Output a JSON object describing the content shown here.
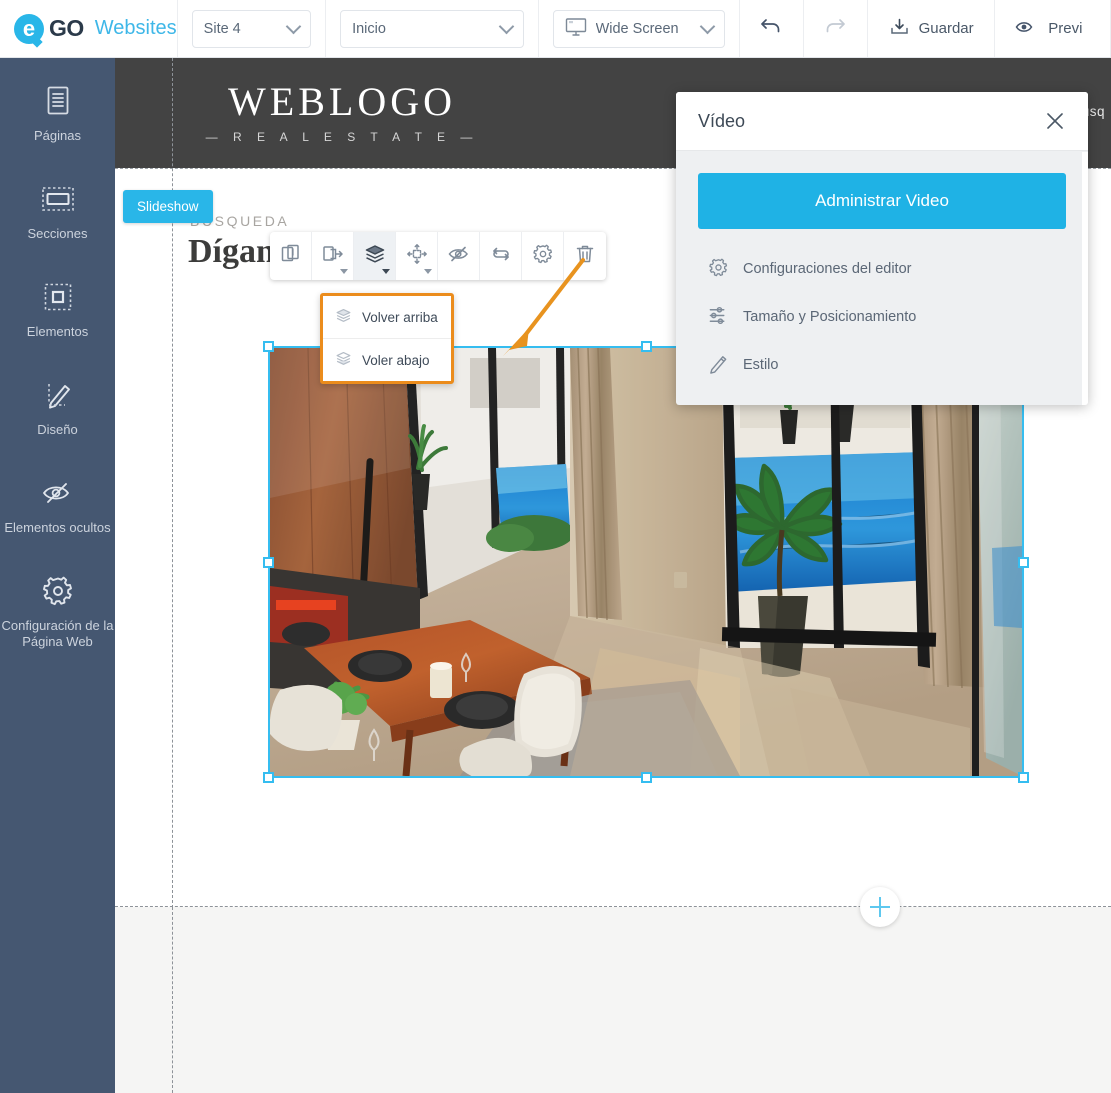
{
  "topbar": {
    "brand": {
      "mark": "e",
      "go": "GO",
      "word": "Websites"
    },
    "site_select": {
      "value": "Site 4",
      "icon": "chevron-down-icon"
    },
    "page_select": {
      "value": "Inicio",
      "icon": "chevron-down-icon"
    },
    "screen_select": {
      "value": "Wide Screen",
      "icon": "monitor-icon"
    },
    "undo": {
      "icon": "undo-arrow-icon"
    },
    "redo": {
      "icon": "redo-arrow-icon"
    },
    "save": {
      "label": "Guardar",
      "icon": "download-save-icon"
    },
    "preview": {
      "label": "Previ",
      "icon": "eye-preview-icon"
    }
  },
  "sidebar": {
    "items": [
      {
        "label": "Páginas",
        "icon": "pages-document-icon"
      },
      {
        "label": "Secciones",
        "icon": "sections-block-icon"
      },
      {
        "label": "Elementos",
        "icon": "elements-square-icon"
      },
      {
        "label": "Diseño",
        "icon": "design-pencil-icon"
      },
      {
        "label": "Elementos ocultos",
        "icon": "hidden-eye-slash-icon"
      },
      {
        "label": "Configuración de la Página Web",
        "icon": "gear-settings-icon"
      }
    ]
  },
  "canvas": {
    "site_header": {
      "logo_main": "WEBLOGO",
      "logo_sub": "— R E A L   E S T A T E —",
      "nav_cut": "úsq"
    },
    "slideshow_badge": "Slideshow",
    "add_section_icon": "plus-circle-icon",
    "lower_section": {
      "kicker": "BÚSQUEDA",
      "headline": "Díganos qué busca"
    }
  },
  "element_toolbar": {
    "buttons": [
      {
        "name": "duplicate",
        "icon": "duplicate-pages-icon",
        "has_caret": false,
        "active": false
      },
      {
        "name": "move-to-page",
        "icon": "move-to-page-arrow-icon",
        "has_caret": true,
        "active": false
      },
      {
        "name": "layers",
        "icon": "layers-stack-icon",
        "has_caret": true,
        "active": true
      },
      {
        "name": "position",
        "icon": "move-arrows-icon",
        "has_caret": true,
        "active": false
      },
      {
        "name": "hide",
        "icon": "eye-slash-icon",
        "has_caret": false,
        "active": false
      },
      {
        "name": "swap",
        "icon": "swap-arrows-icon",
        "has_caret": false,
        "active": false
      },
      {
        "name": "settings",
        "icon": "gear-icon",
        "has_caret": false,
        "active": false
      },
      {
        "name": "delete",
        "icon": "trash-icon",
        "has_caret": false,
        "active": false
      }
    ]
  },
  "layers_menu": {
    "items": [
      {
        "label": "Volver arriba",
        "icon": "layers-up-icon"
      },
      {
        "label": "Voler abajo",
        "icon": "layers-down-icon"
      }
    ],
    "highlight_color": "#eb8c1c"
  },
  "annotation": {
    "arrow_color": "#e8931f",
    "points_to": "layers-stack-icon"
  },
  "right_panel": {
    "title": "Vídeo",
    "close_icon": "close-x-icon",
    "cta_label": "Administrar Video",
    "cta_color": "#1fb2e5",
    "menu": [
      {
        "label": "Configuraciones del editor",
        "icon": "gear-icon"
      },
      {
        "label": "Tamaño y Posicionamiento",
        "icon": "sliders-icon"
      },
      {
        "label": "Estilo",
        "icon": "pencil-icon"
      }
    ]
  },
  "selection": {
    "color": "#35bdf0",
    "handles": [
      "top-left",
      "top-center",
      "top-right",
      "middle-left",
      "middle-right",
      "bottom-left",
      "bottom-center",
      "bottom-right"
    ]
  },
  "colors": {
    "brand_blue": "#3eb7e8",
    "sidebar_bg": "#455771",
    "site_header_bg": "#434343",
    "accent_orange": "#eb8c1c",
    "selection_cyan": "#35bdf0"
  }
}
